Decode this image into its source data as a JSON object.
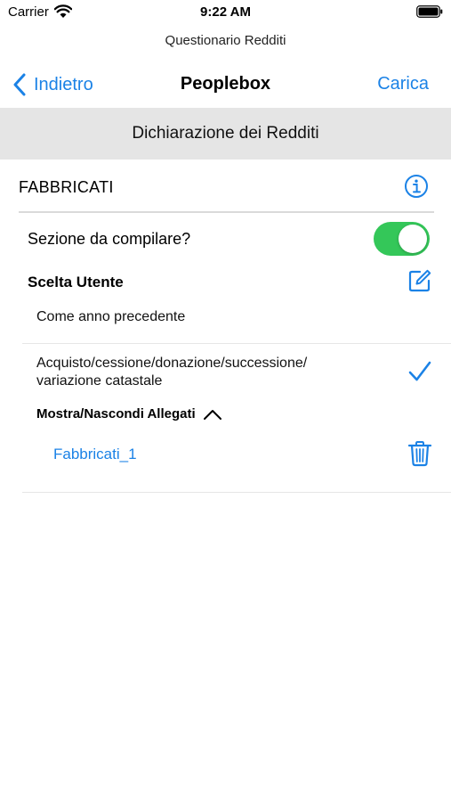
{
  "status_bar": {
    "carrier": "Carrier",
    "time": "9:22 AM"
  },
  "app_title": "Questionario Redditi",
  "nav": {
    "back_label": "Indietro",
    "title": "Peoplebox",
    "action_label": "Carica"
  },
  "section_banner": "Dichiarazione dei Redditi",
  "category": {
    "title": "FABBRICATI",
    "info_icon": "info-circle-icon"
  },
  "toggle_row": {
    "label": "Sezione da compilare?",
    "enabled": true
  },
  "user_choice": {
    "label": "Scelta Utente",
    "value": "Come anno precedente",
    "edit_icon": "edit-square-icon"
  },
  "option": {
    "text": "Acquisto/cessione/donazione/successione/\nvariazione catastale",
    "selected": true
  },
  "attachments": {
    "toggle_label": "Mostra/Nascondi Allegati",
    "items": [
      {
        "name": "Fabbricati_1"
      }
    ]
  },
  "colors": {
    "accent": "#1b82e6",
    "toggle_on": "#34c759",
    "banner_bg": "#e5e5e5"
  }
}
